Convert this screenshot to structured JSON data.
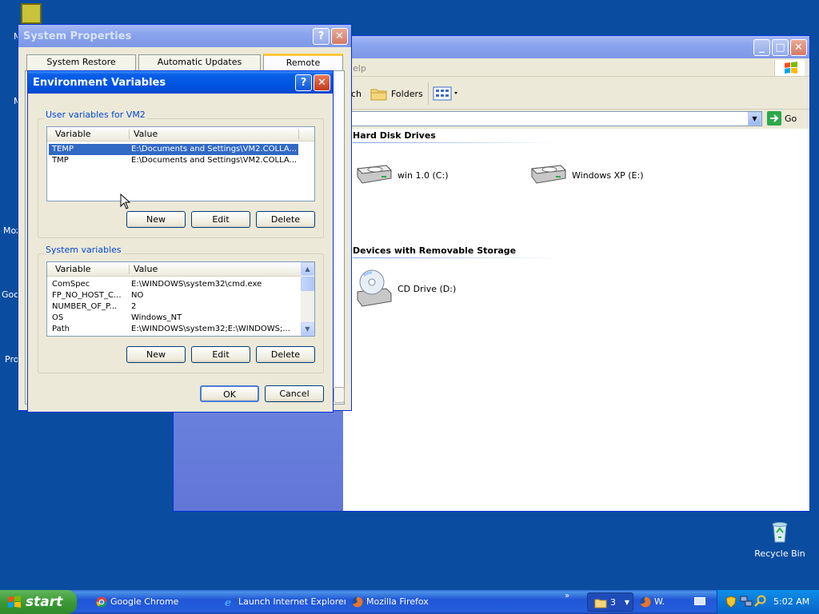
{
  "desktop": {
    "left_labels": [
      "M",
      "M",
      "Moz",
      "Goo",
      "Pro"
    ],
    "recycle_bin": "Recycle Bin"
  },
  "system_properties": {
    "title": "System Properties",
    "tabs": [
      "System Restore",
      "Automatic Updates",
      "Remote"
    ]
  },
  "explorer": {
    "menu_help_fragment": "elp",
    "toolbar_search_fragment": "ch",
    "toolbar_folders": "Folders",
    "go_label": "Go",
    "sections": [
      {
        "heading": "Hard Disk Drives",
        "drives": [
          "win 1.0 (C:)",
          "Windows XP (E:)"
        ]
      },
      {
        "heading": "Devices with Removable Storage",
        "drives": [
          "CD Drive (D:)"
        ]
      }
    ]
  },
  "env_dialog": {
    "title": "Environment Variables",
    "user_group_label": "User variables for VM2",
    "system_group_label": "System variables",
    "col_variable": "Variable",
    "col_value": "Value",
    "user_vars": [
      {
        "name": "TEMP",
        "value": "E:\\Documents and Settings\\VM2.COLLA..."
      },
      {
        "name": "TMP",
        "value": "E:\\Documents and Settings\\VM2.COLLA..."
      }
    ],
    "system_vars": [
      {
        "name": "ComSpec",
        "value": "E:\\WINDOWS\\system32\\cmd.exe"
      },
      {
        "name": "FP_NO_HOST_C...",
        "value": "NO"
      },
      {
        "name": "NUMBER_OF_P...",
        "value": "2"
      },
      {
        "name": "OS",
        "value": "Windows_NT"
      },
      {
        "name": "Path",
        "value": "E:\\WINDOWS\\system32;E:\\WINDOWS;..."
      }
    ],
    "new_label": "New",
    "edit_label": "Edit",
    "delete_label": "Delete",
    "ok_label": "OK",
    "cancel_label": "Cancel"
  },
  "taskbar": {
    "start_label": "start",
    "tasks": [
      "Google Chrome",
      "Launch Internet Explorer...",
      "Mozilla Firefox"
    ],
    "group_count": "3",
    "firefox_fragment": "W.",
    "clock": "5:02 AM"
  },
  "colors": {
    "desktop": "#0a4da0",
    "title_active": "#0054e3",
    "selection": "#316ac5",
    "group_label": "#0046d5"
  }
}
